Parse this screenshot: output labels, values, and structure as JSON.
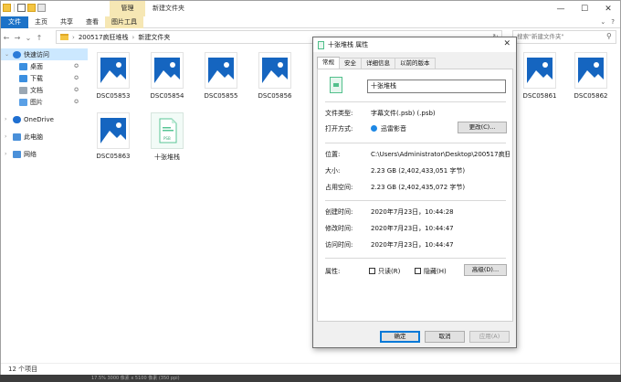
{
  "explorer": {
    "manage_tab": "管理",
    "window_title": "新建文件夹",
    "ribbon_tabs": [
      "文件",
      "主页",
      "共享",
      "查看",
      "图片工具"
    ],
    "address": {
      "crumbs": [
        "200517疯狂堆栈",
        "新建文件夹"
      ],
      "search_placeholder": "搜索\"新建文件夹\""
    },
    "sidebar": {
      "items": [
        {
          "label": "快速访问",
          "icon": "star-icon"
        },
        {
          "label": "桌面",
          "icon": "desktop-icon"
        },
        {
          "label": "下载",
          "icon": "download-icon"
        },
        {
          "label": "文档",
          "icon": "documents-icon"
        },
        {
          "label": "图片",
          "icon": "pictures-icon"
        },
        {
          "label": "OneDrive",
          "icon": "cloud-icon"
        },
        {
          "label": "此电脑",
          "icon": "computer-icon"
        },
        {
          "label": "网络",
          "icon": "network-icon"
        }
      ]
    },
    "files": [
      {
        "name": "DSC05853",
        "type": "image"
      },
      {
        "name": "DSC05854",
        "type": "image"
      },
      {
        "name": "DSC05855",
        "type": "image"
      },
      {
        "name": "DSC05856",
        "type": "image"
      },
      {
        "name": "DSC05861",
        "type": "image"
      },
      {
        "name": "DSC05862",
        "type": "image"
      },
      {
        "name": "DSC05863",
        "type": "image"
      },
      {
        "name": "十张堆栈",
        "type": "psb",
        "badge": "PSB"
      }
    ],
    "status": "12 个项目",
    "bottom_strip": "17.5%    3000 像素 x 5100 像素 (350 ppi)"
  },
  "dialog": {
    "title": "十张堆栈 属性",
    "tabs": [
      "常规",
      "安全",
      "详细信息",
      "以前的版本"
    ],
    "file_name": "十张堆栈",
    "file_type_label": "文件类型:",
    "file_type": "字幕文件(.psb) (.psb)",
    "opens_with_label": "打开方式:",
    "opens_with": "迅雷影音",
    "change_button": "更改(C)...",
    "location_label": "位置:",
    "location": "C:\\Users\\Administrator\\Desktop\\200517疯狂堆栈\\",
    "size_label": "大小:",
    "size": "2.23 GB (2,402,433,051 字节)",
    "size_on_disk_label": "占用空间:",
    "size_on_disk": "2.23 GB (2,402,435,072 字节)",
    "created_label": "创建时间:",
    "created": "2020年7月23日，10:44:28",
    "modified_label": "修改时间:",
    "modified": "2020年7月23日，10:44:47",
    "accessed_label": "访问时间:",
    "accessed": "2020年7月23日，10:44:47",
    "attributes_label": "属性:",
    "readonly_label": "只读(R)",
    "hidden_label": "隐藏(H)",
    "advanced_button": "高级(D)...",
    "ok_button": "确定",
    "cancel_button": "取消",
    "apply_button": "应用(A)"
  }
}
